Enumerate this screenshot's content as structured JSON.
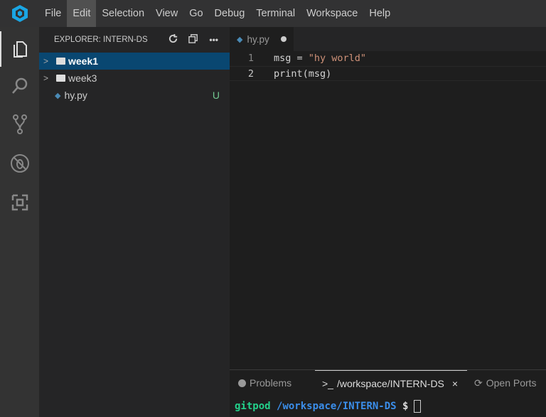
{
  "menu": [
    "File",
    "Edit",
    "Selection",
    "View",
    "Go",
    "Debug",
    "Terminal",
    "Workspace",
    "Help"
  ],
  "sidebar": {
    "title": "EXPLORER: INTERN-DS",
    "items": [
      {
        "label": "week1"
      },
      {
        "label": "week3"
      },
      {
        "label": "hy.py",
        "badge": "U"
      }
    ]
  },
  "editor": {
    "tab": "hy.py",
    "lines": [
      {
        "n": "1",
        "a": "msg = ",
        "s": "\"hy world\""
      },
      {
        "n": "2",
        "a": "print(msg)",
        "s": ""
      }
    ]
  },
  "panel": {
    "problems": "Problems",
    "terminal": "/workspace/INTERN-DS",
    "terminal_prefix": ">_",
    "ports": "Open Ports",
    "close": "×",
    "prompt_user": "gitpod",
    "prompt_path": "/workspace/INTERN-DS",
    "prompt_symbol": "$"
  }
}
